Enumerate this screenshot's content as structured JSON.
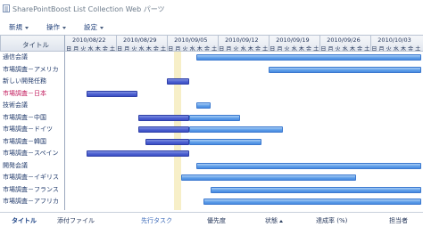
{
  "app": {
    "title": "SharePointBoost List Collection Web パーツ"
  },
  "toolbar": {
    "items": [
      {
        "label": "新規",
        "icon": "chevron-down-icon"
      },
      {
        "label": "操作",
        "icon": "chevron-down-icon"
      },
      {
        "label": "設定",
        "icon": "chevron-down-icon"
      }
    ]
  },
  "grid": {
    "title_header": "タイトル",
    "weeks": [
      "2010/08/22",
      "2010/08/29",
      "2010/09/05",
      "2010/09/12",
      "2010/09/19",
      "2010/09/26",
      "2010/10/03"
    ],
    "day_labels": [
      "日",
      "月",
      "火",
      "水",
      "木",
      "金",
      "土"
    ],
    "rows": [
      {
        "name": "通信会議",
        "selected": false,
        "bars": [
          {
            "start": 18,
            "end": 49,
            "style": "light"
          }
        ]
      },
      {
        "name": "市場調査－アメリカ",
        "selected": false,
        "bars": [
          {
            "start": 28,
            "end": 49,
            "style": "light"
          }
        ]
      },
      {
        "name": "新しい開発任務",
        "selected": false,
        "bars": [
          {
            "start": 14,
            "end": 17,
            "style": "dark"
          }
        ]
      },
      {
        "name": "市場調査－日本",
        "selected": true,
        "bars": [
          {
            "start": 3,
            "end": 10,
            "style": "dark"
          }
        ]
      },
      {
        "name": "技術会議",
        "selected": false,
        "bars": [
          {
            "start": 18,
            "end": 20,
            "style": "light"
          }
        ]
      },
      {
        "name": "市場調査－中国",
        "selected": false,
        "bars": [
          {
            "start": 10,
            "end": 17,
            "style": "dark"
          },
          {
            "start": 17,
            "end": 24,
            "style": "light"
          }
        ]
      },
      {
        "name": "市場調査－ドイツ",
        "selected": false,
        "bars": [
          {
            "start": 10,
            "end": 17,
            "style": "dark"
          },
          {
            "start": 17,
            "end": 30,
            "style": "light"
          }
        ]
      },
      {
        "name": "市場調査－韓国",
        "selected": false,
        "bars": [
          {
            "start": 11,
            "end": 17,
            "style": "dark"
          },
          {
            "start": 17,
            "end": 27,
            "style": "light"
          }
        ]
      },
      {
        "name": "市場調査－スペイン",
        "selected": false,
        "bars": [
          {
            "start": 3,
            "end": 17,
            "style": "dark"
          }
        ]
      },
      {
        "name": "開発会議",
        "selected": false,
        "bars": [
          {
            "start": 18,
            "end": 49,
            "style": "light"
          }
        ]
      },
      {
        "name": "市場調査－イギリス",
        "selected": false,
        "bars": [
          {
            "start": 16,
            "end": 40,
            "style": "light"
          }
        ]
      },
      {
        "name": "市場調査－フランス",
        "selected": false,
        "bars": [
          {
            "start": 20,
            "end": 49,
            "style": "light"
          }
        ]
      },
      {
        "name": "市場調査－アフリカ",
        "selected": false,
        "bars": [
          {
            "start": 19,
            "end": 49,
            "style": "light"
          }
        ]
      }
    ]
  },
  "footer": {
    "columns": [
      {
        "label": "タイトル",
        "active": true,
        "sort": false,
        "link": false
      },
      {
        "label": "添付ファイル",
        "active": false,
        "sort": false,
        "link": false
      },
      {
        "label": "先行タスク",
        "active": false,
        "sort": false,
        "link": true
      },
      {
        "label": "優先度",
        "active": false,
        "sort": false,
        "link": false
      },
      {
        "label": "状態",
        "active": false,
        "sort": true,
        "link": false
      },
      {
        "label": "達成率 (%)",
        "active": false,
        "sort": false,
        "link": false
      },
      {
        "label": "担当者",
        "active": false,
        "sort": false,
        "link": false
      }
    ]
  },
  "colors": {
    "bar_light": "#5b9ce8",
    "bar_dark": "#4a5ed0",
    "today": "#f7efc8",
    "selected_row_text": "#c2185b"
  }
}
